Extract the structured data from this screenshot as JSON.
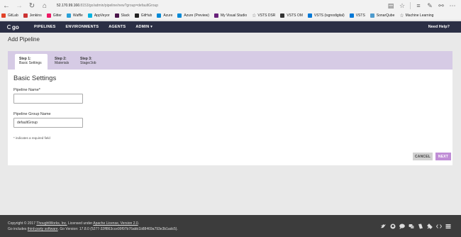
{
  "browser": {
    "url_host": "52.170.99.166",
    "url_path": ":8153/go/admin/pipeline/new?group=defaultGroup"
  },
  "bookmarks": [
    {
      "label": "GitLab",
      "icon": "gitlab-icon",
      "color": "#e24329"
    },
    {
      "label": "Jenkins",
      "icon": "jenkins-icon",
      "color": "#c33"
    },
    {
      "label": "Gitter",
      "icon": "gitter-icon",
      "color": "#ed1965"
    },
    {
      "label": "Waffle",
      "icon": "waffle-icon",
      "color": "#2aa1d8"
    },
    {
      "label": "AppVeyor",
      "icon": "appveyor-icon",
      "color": "#00b3e0"
    },
    {
      "label": "Slack",
      "icon": "slack-icon",
      "color": "#4a154b"
    },
    {
      "label": "GitHub",
      "icon": "github-icon",
      "color": "#222"
    },
    {
      "label": "Azure",
      "icon": "azure-icon",
      "color": "#0089d6"
    },
    {
      "label": "Azure (Preview)",
      "icon": "azure-preview-icon",
      "color": "#0089d6"
    },
    {
      "label": "My Visual Studio",
      "icon": "visual-studio-icon",
      "color": "#68217a"
    },
    {
      "label": "VSTS DSR",
      "icon": "star-icon",
      "color": "#555"
    },
    {
      "label": "VSTS OM",
      "icon": "vsts-om-icon",
      "color": "#333"
    },
    {
      "label": "VSTS (isgnodigital)",
      "icon": "vsts-icon",
      "color": "#0078d7"
    },
    {
      "label": "VSTS",
      "icon": "vsts-icon",
      "color": "#0078d7"
    },
    {
      "label": "SonarQube",
      "icon": "sonarqube-icon",
      "color": "#4e9bcd"
    },
    {
      "label": "Machine Learning",
      "icon": "star-icon",
      "color": "#555"
    }
  ],
  "header": {
    "logo_text": "go",
    "nav": [
      "PIPELINES",
      "ENVIRONMENTS",
      "AGENTS",
      "ADMIN ▾"
    ],
    "help": "Need Help?"
  },
  "page": {
    "title": "Add Pipeline"
  },
  "steps": [
    {
      "number": "Step 1:",
      "label": "Basic Settings",
      "active": true
    },
    {
      "number": "Step 2:",
      "label": "Materials",
      "active": false
    },
    {
      "number": "Step 3:",
      "label": "Stage/Job",
      "active": false
    }
  ],
  "form": {
    "section_title": "Basic Settings",
    "pipeline_name_label": "Pipeline Name*",
    "pipeline_name_value": "",
    "group_name_label": "Pipeline Group Name",
    "group_name_value": "defaultGroup",
    "required_note": "* indicates a required field",
    "cancel_label": "CANCEL",
    "next_label": "NEXT"
  },
  "footer": {
    "copyright_prefix": "Copyright © 2017 ",
    "company_link": "ThoughtWorks, Inc.",
    "licensed_text": " Licensed under ",
    "license_link": "Apache License, Version 2.0",
    "license_suffix": ".",
    "includes_prefix": "Go includes ",
    "third_party_link": "third-party software",
    "version_text": ". Go Version: 17.8.0 (5277-32ff863cce99f97b76abb1b88469a793e3b1adc5)."
  },
  "colors": {
    "header_bg": "#2b2f45",
    "steps_bg": "#d6cbe5",
    "next_button": "#c08ed6",
    "footer_bg": "#3c3c3c"
  }
}
